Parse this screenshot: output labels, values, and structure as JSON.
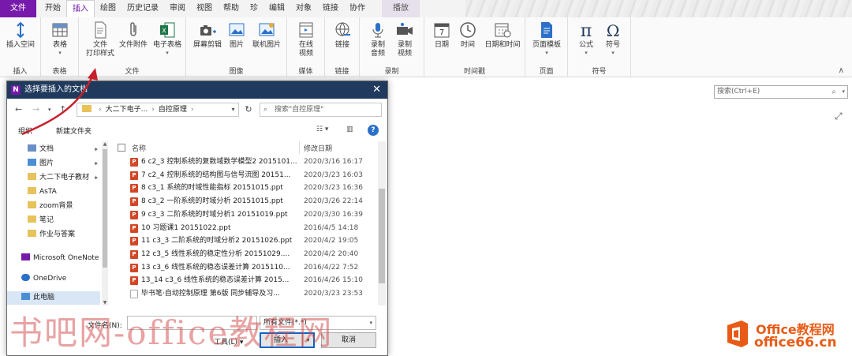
{
  "tabbar": {
    "file_label": "文件",
    "tabs": [
      "开始",
      "插入",
      "绘图",
      "历史记录",
      "审阅",
      "视图",
      "帮助",
      "珍",
      "编辑",
      "对象",
      "链接",
      "协作"
    ],
    "playback_label": "播放"
  },
  "ribbon": {
    "groups": {
      "insert": "插入",
      "tables": "表格",
      "files": "文件",
      "images": "图像",
      "media": "媒体",
      "links": "链接",
      "recording": "录制",
      "timestamp": "时间戳",
      "pages": "页面",
      "symbols": "符号"
    },
    "buttons": {
      "insert_space": "插入空间",
      "table": "表格",
      "file_printout_l1": "文件",
      "file_printout_l2": "打印样式",
      "file_attachment": "文件附件",
      "spreadsheet": "电子表格",
      "screen_clip": "屏幕剪辑",
      "picture": "图片",
      "online_picture": "联机图片",
      "online_video_l1": "在线",
      "online_video_l2": "视频",
      "link": "链接",
      "record_audio_l1": "录制",
      "record_audio_l2": "音频",
      "record_video_l1": "录制",
      "record_video_l2": "视频",
      "date": "日期",
      "time": "时间",
      "date_time": "日期和时间",
      "page_template": "页面模板",
      "equation": "公式",
      "symbol": "符号"
    },
    "calendar_number": "7"
  },
  "search": {
    "placeholder": "搜索(Ctrl+E)"
  },
  "dialog": {
    "title": "选择要插入的文档",
    "path": [
      "大二下电子...",
      "自控原理"
    ],
    "search_placeholder": "搜索\"自控原理\"",
    "organize": "组织",
    "new_folder": "新建文件夹",
    "columns": {
      "name": "名称",
      "modified": "修改日期"
    },
    "nav": [
      {
        "label": "文档",
        "pinned": true
      },
      {
        "label": "图片",
        "pinned": true
      },
      {
        "label": "大二下电子教材",
        "pinned": true
      },
      {
        "label": "AsTA",
        "pinned": false
      },
      {
        "label": "zoom背景",
        "pinned": false
      },
      {
        "label": "笔记",
        "pinned": false
      },
      {
        "label": "作业与答案",
        "pinned": false
      },
      {
        "label": "Microsoft OneNote",
        "pinned": false
      },
      {
        "label": "OneDrive",
        "pinned": false
      },
      {
        "label": "此电脑",
        "pinned": false
      }
    ],
    "files": [
      {
        "name": "6 c2_3 控制系统的复数域数学模型2 2015101...",
        "date": "2020/3/16 16:17"
      },
      {
        "name": "7 c2_4 控制系统的结构图与信号流图 20151...",
        "date": "2020/3/23 16:03"
      },
      {
        "name": "8 c3_1 系统的时域性能指标 20151015.ppt",
        "date": "2020/3/23 16:36"
      },
      {
        "name": "8 c3_2 一阶系统的时域分析 20151015.ppt",
        "date": "2020/3/26 22:14"
      },
      {
        "name": "9 c3_3 二阶系统的时域分析1 20151019.ppt",
        "date": "2020/3/30 16:39"
      },
      {
        "name": "10 习题课1 20151022.ppt",
        "date": "2016/4/5 14:18"
      },
      {
        "name": "11 c3_3 二阶系统的时域分析2 20151026.ppt",
        "date": "2020/4/2 19:05"
      },
      {
        "name": "12 c3_5 线性系统的稳定性分析 20151029....",
        "date": "2020/4/2 20:40"
      },
      {
        "name": "13 c3_6 线性系统的稳态误差计算 2015110...",
        "date": "2016/4/22 7:52"
      },
      {
        "name": "13_14 c3_6 线性系统的稳态误差计算 2015...",
        "date": "2016/4/26 15:10"
      },
      {
        "name": "毕书笔·自动控制原理 第6版 同步辅导及习...",
        "date": "2020/3/23 23:53"
      }
    ],
    "filename_label": "文件名(N):",
    "filter_value": "所有文件(*.*)",
    "tools_label": "工具(L)",
    "insert_label": "插入",
    "cancel_label": "取消"
  },
  "watermark": {
    "text": "书吧网-office教程网",
    "logo_line1": "Office教程网",
    "logo_line2": "office66.cn"
  },
  "colors": {
    "accent": "#7719aa",
    "dialog_title": "#1f3a5c",
    "ppt": "#d24726",
    "arrow": "#c8202a",
    "logo": "#e85b16"
  }
}
